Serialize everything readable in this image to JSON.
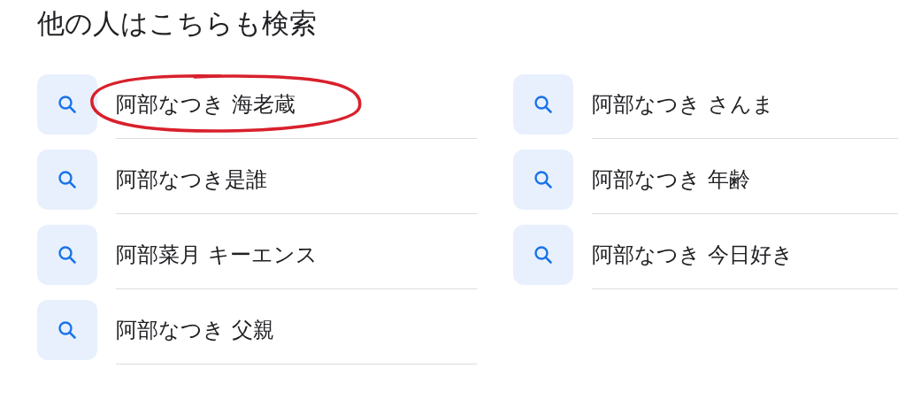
{
  "title": "他の人はこちらも検索",
  "suggestions": [
    {
      "text": "阿部なつき 海老蔵",
      "circled": true
    },
    {
      "text": "阿部なつき さんま",
      "circled": false
    },
    {
      "text": "阿部なつき是誰",
      "circled": false
    },
    {
      "text": "阿部なつき 年齢",
      "circled": false
    },
    {
      "text": "阿部菜月 キーエンス",
      "circled": false
    },
    {
      "text": "阿部なつき 今日好き",
      "circled": false
    },
    {
      "text": "阿部なつき 父親",
      "circled": false
    }
  ]
}
